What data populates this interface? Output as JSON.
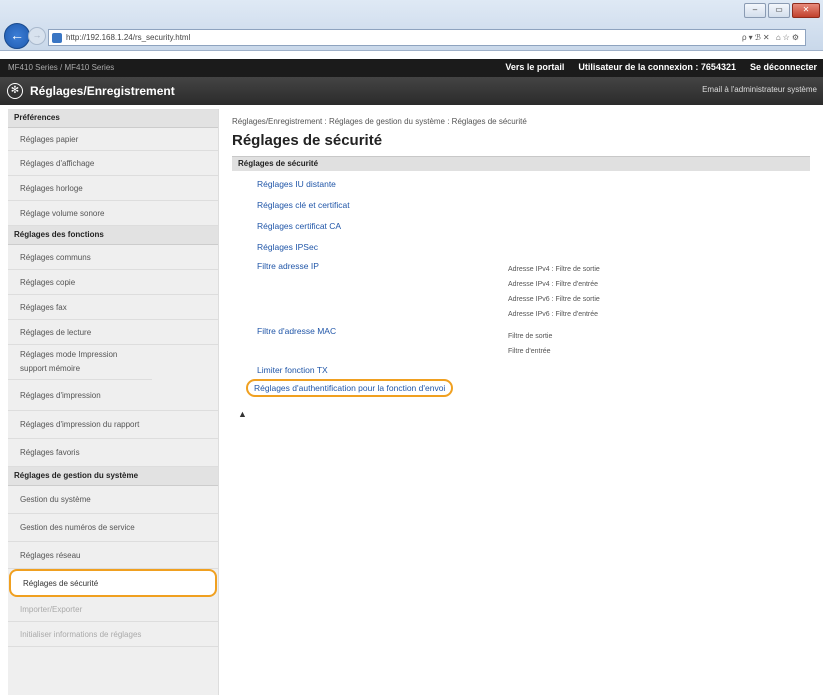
{
  "browser": {
    "url": "http://192.168.1.24/rs_security.html",
    "toolbar_glyphs": "ρ▾ℬ✕ ⌂☆⚙",
    "win_min": "‒",
    "win_max": "▭",
    "win_close": "✕"
  },
  "header": {
    "portal_link": "Vers le portail",
    "user_label": "Utilisateur de la connexion :",
    "user_id": "7654321",
    "logout": "Se déconnecter",
    "device_text": "MF410 Series / MF410 Series"
  },
  "titlebar": {
    "title": "Réglages/Enregistrement",
    "mail": "Email à l'administrateur système"
  },
  "sidebar": {
    "sections": [
      {
        "label": "Préférences",
        "items": [
          "Réglages papier",
          "Réglages d'affichage",
          "Réglages horloge",
          "Réglage volume sonore"
        ]
      },
      {
        "label": "Réglages des fonctions",
        "items": [
          "Réglages communs",
          "Réglages copie",
          "Réglages fax",
          "Réglages de lecture",
          "Réglages mode Impression support mémoire",
          "Réglages d'impression",
          "Réglages d'impression du rapport",
          "Réglages favoris"
        ]
      },
      {
        "label": "Réglages de gestion du système",
        "items": [
          "Gestion du système",
          "Gestion des numéros de service",
          "Réglages réseau",
          "Réglages de sécurité",
          "Importer/Exporter",
          "Initialiser informations de réglages"
        ]
      }
    ]
  },
  "main": {
    "breadcrumb": "Réglages/Enregistrement : Réglages de gestion du système : Réglages de sécurité",
    "title": "Réglages de sécurité",
    "section": "Réglages de sécurité",
    "links": [
      "Réglages IU distante",
      "Réglages clé et certificat",
      "Réglages certificat CA",
      "Réglages IPSec",
      "Filtre adresse IP",
      "Filtre d'adresse MAC",
      "Limiter fonction TX",
      "Réglages d'authentification pour la fonction d'envoi"
    ],
    "ip_filter_desc": [
      "Adresse IPv4 : Filtre de sortie",
      "Adresse IPv4 : Filtre d'entrée",
      "Adresse IPv6 : Filtre de sortie",
      "Adresse IPv6 : Filtre d'entrée"
    ],
    "mac_filter_desc": [
      "Filtre de sortie",
      "Filtre d'entrée"
    ],
    "top_glyph": "▲"
  }
}
